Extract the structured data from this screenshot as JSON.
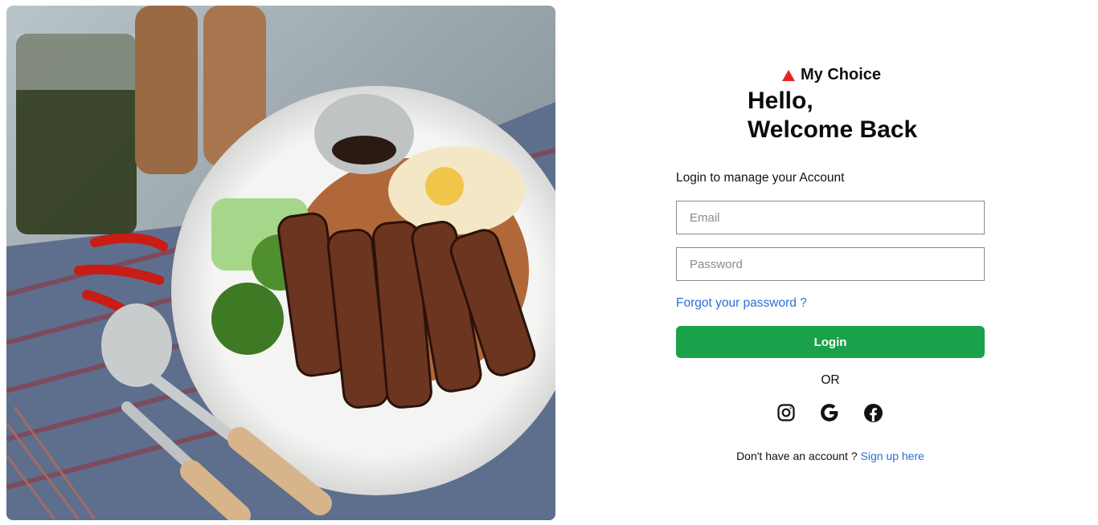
{
  "brand": {
    "name": "My Choice",
    "logo_icon": "triangle-logo-icon",
    "logo_color": "#e0262a"
  },
  "greeting": {
    "line1": "Hello,",
    "line2": "Welcome Back"
  },
  "subtitle": "Login to manage your Account",
  "form": {
    "email_placeholder": "Email",
    "email_value": "",
    "password_placeholder": "Password",
    "password_value": "",
    "forgot_label": "Forgot your password ?",
    "login_label": "Login"
  },
  "divider": "OR",
  "social": [
    "instagram-icon",
    "google-icon",
    "facebook-icon"
  ],
  "signup": {
    "prompt": "Don't have an account ?",
    "link": "Sign up here"
  },
  "colors": {
    "accent": "#1aa14a",
    "link": "#2c6ed5"
  }
}
